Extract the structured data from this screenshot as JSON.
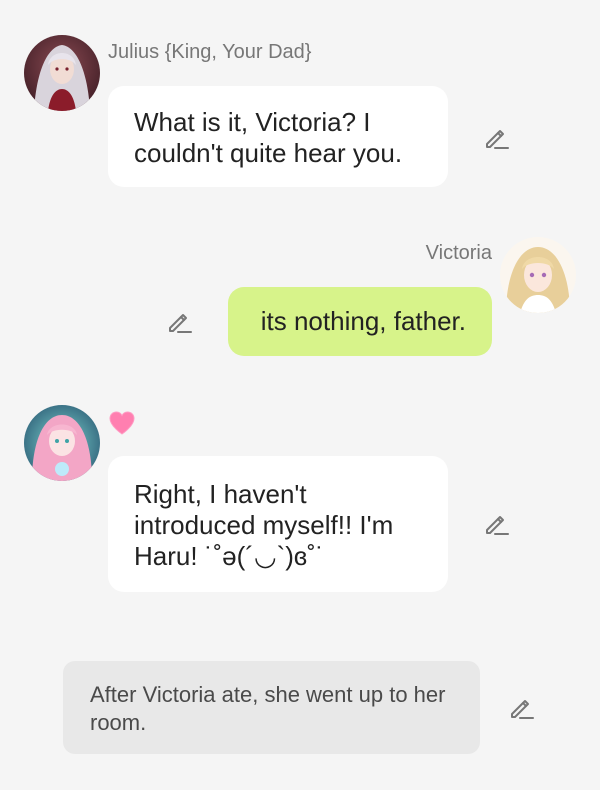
{
  "messages": [
    {
      "sender": "Julius {King, Your Dad}",
      "text": "What is it, Victoria? I couldn't quite hear you.",
      "role": "character",
      "avatar": "julius-avatar"
    },
    {
      "sender": "Victoria",
      "text": "its nothing, father.",
      "role": "user",
      "avatar": "victoria-avatar"
    },
    {
      "sender": "",
      "text": "Right, I haven't introduced myself!! I'm Haru! ˙˚ə(´◡`)ɞ˚˙",
      "role": "character",
      "avatar": "haru-avatar",
      "reaction": "heart"
    },
    {
      "text": "After Victoria ate, she went up to her room.",
      "role": "narration"
    }
  ],
  "icons": {
    "edit": "pencil-edit-icon",
    "reaction": "heart-icon"
  },
  "colors": {
    "background": "#f5f5f5",
    "character_bubble": "#ffffff",
    "user_bubble": "#d7f38a",
    "narration_bubble": "#e8e8e8",
    "heart": "#ff7fb0"
  }
}
